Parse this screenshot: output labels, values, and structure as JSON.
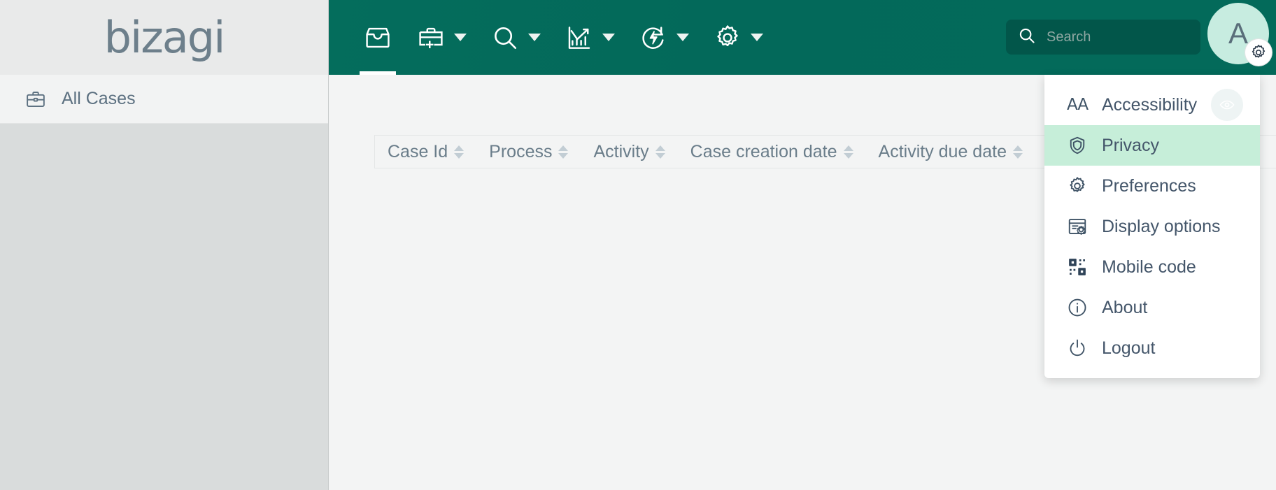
{
  "brand": {
    "logo_text": "bizagi",
    "accent_green": "#046d5c",
    "accent_dark_green": "#02564a",
    "highlight_green": "#c6eed9",
    "text_slate": "#5c7080"
  },
  "sidebar": {
    "items": [
      {
        "label": "All Cases",
        "icon": "briefcase-icon"
      }
    ]
  },
  "topbar": {
    "nav": [
      {
        "name": "inbox",
        "icon": "inbox-icon",
        "has_caret": false,
        "active": true
      },
      {
        "name": "new-case",
        "icon": "briefcase-plus-icon",
        "has_caret": true,
        "active": false
      },
      {
        "name": "search",
        "icon": "magnifier-icon",
        "has_caret": true,
        "active": false
      },
      {
        "name": "analytics",
        "icon": "chart-icon",
        "has_caret": true,
        "active": false
      },
      {
        "name": "automation",
        "icon": "refresh-bolt-icon",
        "has_caret": true,
        "active": false
      },
      {
        "name": "admin",
        "icon": "gear-icon",
        "has_caret": true,
        "active": false
      }
    ],
    "search": {
      "placeholder": "Search",
      "value": "",
      "icon": "search-icon"
    },
    "avatar": {
      "initial": "A",
      "badge_icon": "gear-icon"
    }
  },
  "table": {
    "columns": [
      {
        "label": "Case Id",
        "sortable": true
      },
      {
        "label": "Process",
        "sortable": true
      },
      {
        "label": "Activity",
        "sortable": true
      },
      {
        "label": "Case creation date",
        "sortable": true
      },
      {
        "label": "Activity due date",
        "sortable": true
      }
    ],
    "rows": []
  },
  "user_menu": {
    "items": [
      {
        "label": "Accessibility",
        "icon": "aa-icon",
        "selected": false,
        "trailing_icon": "eye-icon"
      },
      {
        "label": "Privacy",
        "icon": "shield-icon",
        "selected": true,
        "trailing_icon": null
      },
      {
        "label": "Preferences",
        "icon": "gear-icon",
        "selected": false,
        "trailing_icon": null
      },
      {
        "label": "Display options",
        "icon": "display-gear-icon",
        "selected": false,
        "trailing_icon": null
      },
      {
        "label": "Mobile code",
        "icon": "qr-code-icon",
        "selected": false,
        "trailing_icon": null
      },
      {
        "label": "About",
        "icon": "info-icon",
        "selected": false,
        "trailing_icon": null
      },
      {
        "label": "Logout",
        "icon": "power-icon",
        "selected": false,
        "trailing_icon": null
      }
    ]
  }
}
